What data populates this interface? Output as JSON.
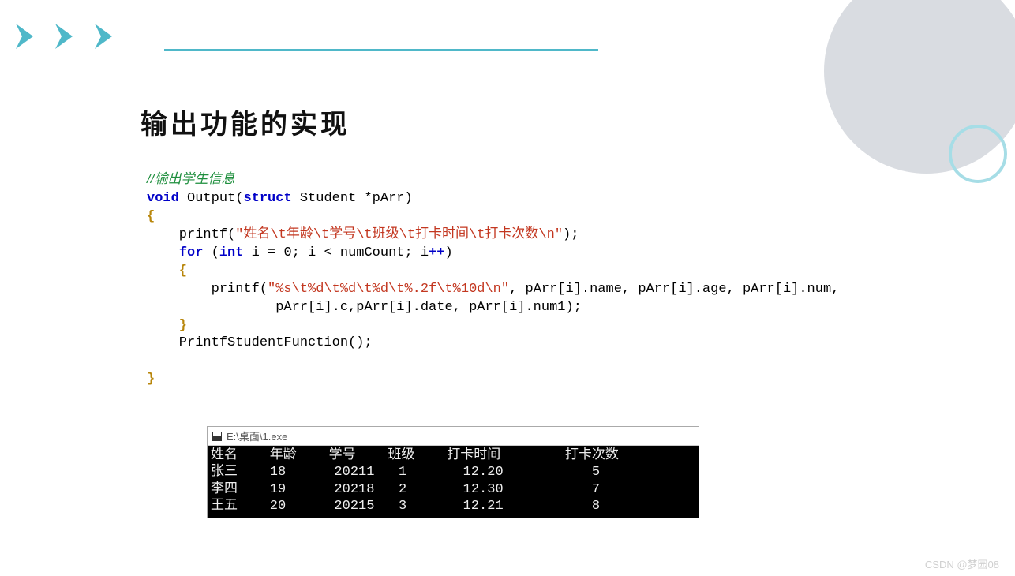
{
  "heading": "输出功能的实现",
  "code": {
    "comment": "//输出学生信息",
    "sig_void": "void",
    "sig_fn": " Output(",
    "sig_struct": "struct",
    "sig_rest": " Student *pArr)",
    "open_brace": "{",
    "printf1_pre": "    printf(",
    "printf1_str": "\"姓名\\t年龄\\t学号\\t班级\\t打卡时间\\t打卡次数\\n\"",
    "printf1_post": ");",
    "for_kw": "for",
    "for_open": " (",
    "for_int": "int",
    "for_init": " i = ",
    "for_zero": "0",
    "for_cond": "; i < numCount; i",
    "for_inc": "++",
    "for_close": ")",
    "for_brace_open": "    {",
    "printf2_pre": "        printf(",
    "printf2_str": "\"%s\\t%d\\t%d\\t%d\\t%.2f\\t%10d\\n\"",
    "printf2_args1": ", pArr[i].name, pArr[i].age, pArr[i].num,",
    "printf2_args2": "                pArr[i].c,pArr[i].date, pArr[i].num1);",
    "for_brace_close": "    }",
    "call": "    PrintfStudentFunction();",
    "close_brace": "}"
  },
  "console": {
    "title": "E:\\桌面\\1.exe",
    "header": "姓名    年龄    学号    班级    打卡时间        打卡次数",
    "rows": [
      "张三    18      20211   1       12.20           5",
      "李四    19      20218   2       12.30           7",
      "王五    20      20215   3       12.21           8"
    ]
  },
  "watermark": "CSDN @梦园08"
}
